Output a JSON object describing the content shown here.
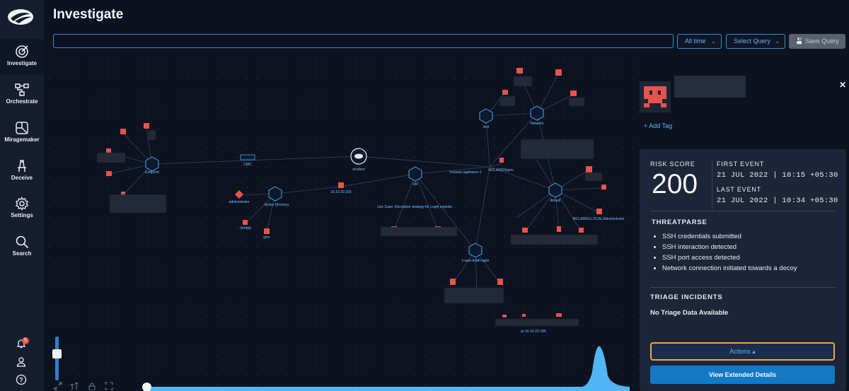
{
  "sidebar": {
    "items": [
      {
        "label": "Investigate",
        "icon": "target-icon",
        "active": true
      },
      {
        "label": "Orchestrate",
        "icon": "workflow-icon"
      },
      {
        "label": "Miragemaker",
        "icon": "miragemaker-icon"
      },
      {
        "label": "Deceive",
        "icon": "decoy-icon"
      },
      {
        "label": "Settings",
        "icon": "gear-icon"
      },
      {
        "label": "Search",
        "icon": "search-icon"
      }
    ],
    "notification_count": "5"
  },
  "header": {
    "title": "Investigate",
    "search_value": "",
    "time_range": "All time",
    "query_select": "Select Query",
    "save_label": "Save Query"
  },
  "graph": {
    "labels": {
      "endpoint": "Endpoint",
      "cmc": "CMC",
      "incident": "incident",
      "active_directory": "Active Directory",
      "administrator": "administrator",
      "krbtgt": "(krbtgt)",
      "gmv": "gmv",
      "ip": "10.10.30.103",
      "dr": "DR",
      "appliance": "mclaren-appliance-1",
      "use_case": "Use Case: Deception strategy for Log4j exploits",
      "test": "test",
      "network": "Network",
      "mclaren_gmv": "MCLAREN\\gmv",
      "default": "default",
      "mclaren_admin": "MCLAREN.LOCAL\\Administrator",
      "antifragile": "z-aws-AntiFragile",
      "ip_host": "ip-10-10-22-185"
    }
  },
  "panel": {
    "add_tag": "Add Tag",
    "risk_label": "RISK SCORE",
    "risk_score": "200",
    "first_event_label": "FIRST EVENT",
    "first_event": "21 JUL 2022 | 10:15 +05:30",
    "last_event_label": "LAST EVENT",
    "last_event": "21 JUL 2022 | 10:34 +05:30",
    "threatparse_label": "THREATPARSE",
    "threats": [
      "SSH credentials submitted",
      "SSH interaction detected",
      "SSH port access detected",
      "Network connection initiated towards a decoy"
    ],
    "triage_label": "TRIAGE INCIDENTS",
    "triage_value": "No Triage Data Available",
    "actions_label": "Actions",
    "details_label": "View Extended Details"
  },
  "colors": {
    "accent": "#2e8fd8",
    "alert_red": "#e8534a",
    "actions_border": "#f1a54b",
    "primary_button": "#1479c5"
  }
}
